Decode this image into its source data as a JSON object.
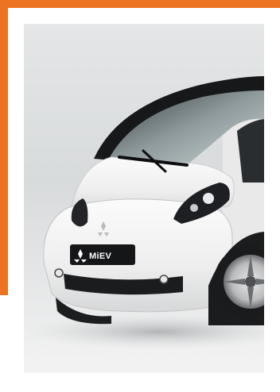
{
  "colors": {
    "accent": "#ec7322",
    "background": "#ffffff",
    "studio_backdrop": "#dcdfe0",
    "car_body": "#f4f4f4",
    "trim_dark": "#1c1c1e"
  },
  "photo": {
    "subject": "car-photo",
    "badge": {
      "logo_icon": "mitsubishi-logo-icon",
      "text": "MiEV"
    }
  }
}
